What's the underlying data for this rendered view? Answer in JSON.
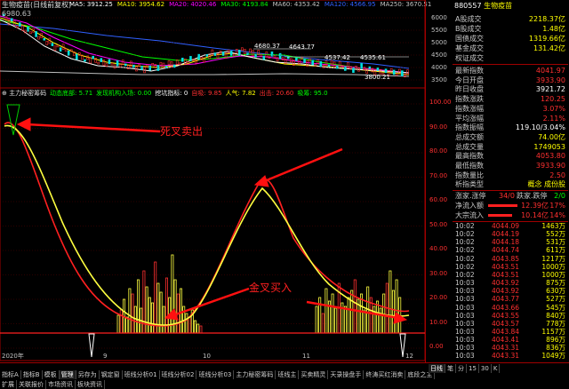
{
  "main_chart": {
    "title": "生物疫苗(日线前复权)",
    "ma_labels": [
      {
        "text": "MA5: 3912.25",
        "color": "#ffffff"
      },
      {
        "text": "MA10: 3954.62",
        "color": "#ffff00"
      },
      {
        "text": "MA20: 4020.46",
        "color": "#ff00ff"
      },
      {
        "text": "MA30: 4193.84",
        "color": "#00ff00"
      },
      {
        "text": "MA60: 4353.42",
        "color": "#c0c0c0"
      },
      {
        "text": "MA120: 4566.95",
        "color": "#3060ff"
      },
      {
        "text": "MA250: 3670.51",
        "color": "#c0c0c0"
      }
    ],
    "price_readout": "6980.63",
    "y_ticks": [
      "6000",
      "5500",
      "5000",
      "4500",
      "4000",
      "3500"
    ],
    "annotations": [
      "4680.37",
      "4643.77",
      "4537.42",
      "4535.61",
      "3800.21"
    ]
  },
  "indicator_panel": {
    "title": "主力秘密筹码",
    "items": [
      {
        "text": "动态底部: 5.71",
        "color": "#00ff00"
      },
      {
        "text": "发现机构入场: 0.00",
        "color": "#00ff00"
      },
      {
        "text": "挖坑指标: 0",
        "color": "#ffffff"
      },
      {
        "text": "自吸: 9.85",
        "color": "#ff3030"
      },
      {
        "text": "人气: 7.82",
        "color": "#ffff00"
      },
      {
        "text": "出击: 20.60",
        "color": "#ff3030"
      },
      {
        "text": "吸筹: 95.0",
        "color": "#00ff00"
      }
    ],
    "y_ticks": [
      "100.00",
      "90.00",
      "80.00",
      "70.00",
      "60.00",
      "50.00",
      "40.00",
      "30.00",
      "20.00",
      "10.00",
      "0.00"
    ],
    "callout_death": "死叉卖出",
    "callout_golden": "金叉买入"
  },
  "time_axis": {
    "labels": [
      "2020年",
      "9",
      "10",
      "11",
      "12"
    ]
  },
  "right_panel": {
    "code": "880557",
    "name": "生物疫苗",
    "turnover_rows": [
      {
        "label": "A股成交",
        "value": "2218.37亿"
      },
      {
        "label": "B股成交",
        "value": "1.48亿"
      },
      {
        "label": "国债成交",
        "value": "1319.66亿"
      },
      {
        "label": "基金成交",
        "value": "131.42亿"
      },
      {
        "label": "权证成交",
        "value": ""
      }
    ],
    "stats_rows": [
      {
        "label": "最新指数",
        "value": "4041.97",
        "color": "#ff3030"
      },
      {
        "label": "今日开盘",
        "value": "3933.90",
        "color": "#ff3030"
      },
      {
        "label": "昨日收盘",
        "value": "3921.72",
        "color": "#ffffff"
      },
      {
        "label": "指数涨跌",
        "value": "120.25",
        "color": "#ff3030"
      },
      {
        "label": "指数涨幅",
        "value": "3.07%",
        "color": "#ff3030"
      },
      {
        "label": "平均涨幅",
        "value": "2.11%",
        "color": "#ff3030"
      },
      {
        "label": "指数振幅",
        "value": "119.10/3.04%",
        "color": "#ffffff"
      },
      {
        "label": "总成交额",
        "value": "74.00亿",
        "color": "#ffff00"
      },
      {
        "label": "总成交量",
        "value": "1749053",
        "color": "#ffff00"
      },
      {
        "label": "最高指数",
        "value": "4053.80",
        "color": "#ff3030"
      },
      {
        "label": "最低指数",
        "value": "3933.90",
        "color": "#ff3030"
      },
      {
        "label": "指数量比",
        "value": "2.50",
        "color": "#ff3030"
      },
      {
        "label": "析指类型",
        "value": "概念 成份股",
        "color": "#ffff00"
      }
    ],
    "updown": {
      "label": "涨家.涨停",
      "value1": "34/0",
      "label2": "跌家.跌停",
      "value2": "2/0"
    },
    "flows": [
      {
        "label": "净流入额",
        "value": "12.39亿",
        "pct": "17%",
        "level": 0.55
      },
      {
        "label": "大宗流入",
        "value": "10.14亿",
        "pct": "14%",
        "level": 0.45
      }
    ],
    "ticks": [
      {
        "time": "10:02",
        "price": "4044.09",
        "vol": "1463万"
      },
      {
        "time": "10:02",
        "price": "4044.19",
        "vol": "552万"
      },
      {
        "time": "10:02",
        "price": "4044.18",
        "vol": "531万"
      },
      {
        "time": "10:02",
        "price": "4044.74",
        "vol": "611万"
      },
      {
        "time": "10:02",
        "price": "4043.85",
        "vol": "1217万"
      },
      {
        "time": "10:02",
        "price": "4043.51",
        "vol": "1000万"
      },
      {
        "time": "10:02",
        "price": "4043.51",
        "vol": "1000万"
      },
      {
        "time": "10:03",
        "price": "4043.92",
        "vol": "875万"
      },
      {
        "time": "10:03",
        "price": "4043.92",
        "vol": "630万"
      },
      {
        "time": "10:03",
        "price": "4043.77",
        "vol": "527万"
      },
      {
        "time": "10:03",
        "price": "4043.66",
        "vol": "545万"
      },
      {
        "time": "10:03",
        "price": "4043.55",
        "vol": "840万"
      },
      {
        "time": "10:03",
        "price": "4043.57",
        "vol": "778万"
      },
      {
        "time": "10:03",
        "price": "4043.84",
        "vol": "1157万"
      },
      {
        "time": "10:03",
        "price": "4043.41",
        "vol": "896万"
      },
      {
        "time": "10:03",
        "price": "4043.31",
        "vol": "836万"
      },
      {
        "time": "10:03",
        "price": "4043.31",
        "vol": "1049万"
      }
    ]
  },
  "bottom_tabs_row1": [
    "指标A",
    "指标B",
    "模板",
    "管理",
    "另存为",
    "钢定窗",
    "班线分析01",
    "班线分析02",
    "班线分析03",
    "主力秘密筹码",
    "班线主",
    "买卖精灵",
    "天录操盘手",
    "终涛买红消卖",
    "底段之主"
  ],
  "bottom_tabs_row2": [
    "扩展",
    "关联报价",
    "市场资讯",
    "板块资讯"
  ],
  "right_bottom_tabs": [
    "日线",
    "笔",
    "分",
    "15",
    "30",
    "K"
  ]
}
